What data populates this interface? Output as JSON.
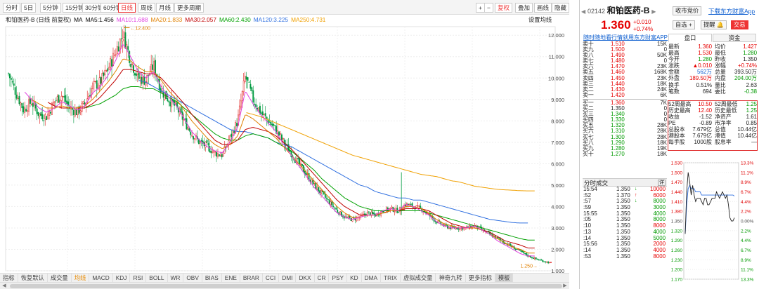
{
  "toolbar": {
    "periods": [
      "分时",
      "5日",
      "5分钟",
      "15分钟",
      "30分钟",
      "60分钟",
      "日线",
      "周线",
      "月线",
      "更多周期"
    ],
    "active_period": "日线",
    "right_buttons": [
      "+",
      "−",
      "复权",
      "叠加",
      "画线",
      "隐藏"
    ]
  },
  "ma_bar": {
    "name": "和铂医药-B (日线 前复权)",
    "items": [
      {
        "label": "MA",
        "value": "",
        "color": "#000000"
      },
      {
        "label": "MA5:",
        "value": "1.456",
        "color": "#000000"
      },
      {
        "label": "MA10:",
        "value": "1.688",
        "color": "#e040e0"
      },
      {
        "label": "MA20:",
        "value": "1.833",
        "color": "#e08000"
      },
      {
        "label": "MA30:",
        "value": "2.057",
        "color": "#c00000"
      },
      {
        "label": "MA60:",
        "value": "2.430",
        "color": "#00a000"
      },
      {
        "label": "MA120:",
        "value": "3.225",
        "color": "#3070e0"
      },
      {
        "label": "MA250:",
        "value": "4.731",
        "color": "#f0a000"
      }
    ],
    "settings": "设置均线"
  },
  "chart_data": {
    "type": "candlestick",
    "y_ticks": [
      "12.000",
      "11.000",
      "10.000",
      "9.000",
      "8.000",
      "7.000",
      "6.000",
      "5.000",
      "4.000",
      "3.000",
      "2.000",
      "1.000"
    ],
    "ylim": [
      1.0,
      12.4
    ],
    "high_label": "12.400",
    "low_label": "1.250",
    "close_path": [
      10.2,
      9.3,
      8.5,
      8.9,
      8.3,
      8.2,
      8.9,
      9.2,
      8.6,
      8.4,
      8.8,
      9.6,
      9.8,
      10.4,
      11.2,
      12.1,
      10.8,
      10.0,
      9.9,
      10.6,
      9.4,
      9.0,
      8.6,
      8.0,
      7.4,
      7.0,
      6.8,
      6.5,
      6.4,
      7.2,
      8.0,
      10.1,
      9.0,
      8.4,
      8.0,
      7.6,
      7.0,
      6.5,
      6.0,
      5.5,
      5.0,
      4.6,
      4.2,
      3.8,
      3.5,
      3.4,
      3.5,
      3.7,
      3.6,
      3.8,
      3.9,
      3.8,
      4.1,
      4.0,
      3.9,
      3.6,
      3.3,
      3.1,
      3.0,
      3.0,
      3.0,
      3.1,
      2.9,
      2.7,
      2.5,
      2.3,
      2.1,
      1.9,
      1.7,
      1.55,
      1.45,
      1.36
    ],
    "ma_lines": [
      {
        "name": "MA250",
        "color": "#f0a000",
        "path": [
          null,
          null,
          null,
          null,
          null,
          null,
          null,
          null,
          null,
          null,
          null,
          null,
          null,
          null,
          null,
          null,
          null,
          null,
          null,
          null,
          null,
          null,
          null,
          null,
          null,
          null,
          null,
          null,
          null,
          null,
          null,
          8.4,
          8.3,
          8.2,
          8.05,
          7.9,
          7.75,
          7.6,
          7.45,
          7.3,
          7.15,
          7.0,
          6.85,
          6.7,
          6.55,
          6.4,
          6.3,
          6.2,
          6.1,
          6.0,
          5.9,
          5.8,
          5.7,
          5.6,
          5.5,
          5.45,
          5.4,
          5.3,
          5.2,
          5.15,
          5.05,
          4.95,
          4.9,
          4.85,
          4.8,
          4.78,
          4.76,
          4.74,
          4.73,
          null,
          null,
          null
        ]
      },
      {
        "name": "MA120",
        "color": "#3070e0",
        "path": [
          null,
          null,
          null,
          null,
          null,
          null,
          null,
          null,
          null,
          null,
          null,
          null,
          null,
          null,
          null,
          null,
          null,
          9.9,
          9.8,
          9.6,
          9.4,
          9.2,
          9.0,
          8.8,
          8.6,
          8.4,
          8.2,
          8.0,
          7.8,
          7.6,
          7.5,
          7.5,
          7.4,
          7.3,
          7.2,
          7.0,
          6.9,
          6.8,
          6.6,
          6.4,
          6.2,
          6.0,
          5.8,
          5.6,
          5.4,
          5.2,
          5.0,
          4.9,
          4.7,
          4.6,
          4.5,
          4.4,
          4.4,
          4.3,
          4.3,
          4.2,
          4.1,
          4.0,
          3.9,
          3.8,
          3.7,
          3.6,
          3.5,
          3.4,
          3.35,
          3.3,
          3.25,
          3.23,
          null,
          null,
          null,
          null
        ]
      },
      {
        "name": "MA60",
        "color": "#00a000",
        "path": [
          null,
          null,
          null,
          null,
          null,
          null,
          null,
          null,
          null,
          null,
          8.6,
          8.7,
          8.8,
          9.0,
          9.2,
          9.5,
          9.6,
          9.6,
          9.5,
          9.5,
          9.3,
          9.1,
          8.9,
          8.6,
          8.3,
          8.0,
          7.7,
          7.4,
          7.2,
          7.1,
          7.1,
          7.3,
          7.4,
          7.3,
          7.2,
          7.0,
          6.8,
          6.6,
          6.3,
          6.0,
          5.7,
          5.3,
          5.0,
          4.7,
          4.4,
          4.2,
          4.0,
          3.9,
          3.8,
          3.8,
          3.8,
          3.8,
          3.8,
          3.8,
          3.8,
          3.7,
          3.6,
          3.5,
          3.4,
          3.3,
          3.2,
          3.1,
          3.0,
          2.9,
          2.8,
          2.7,
          2.6,
          2.5,
          2.43,
          null,
          null,
          null
        ]
      },
      {
        "name": "MA30",
        "color": "#c00000",
        "path": [
          null,
          null,
          null,
          null,
          null,
          8.9,
          8.7,
          8.6,
          8.6,
          8.6,
          8.6,
          8.8,
          9.1,
          9.5,
          9.9,
          10.4,
          10.4,
          10.3,
          10.2,
          10.2,
          10.0,
          9.6,
          9.2,
          8.8,
          8.3,
          7.9,
          7.5,
          7.1,
          6.9,
          6.9,
          7.1,
          7.6,
          7.7,
          7.6,
          7.5,
          7.3,
          7.0,
          6.7,
          6.3,
          5.9,
          5.5,
          5.1,
          4.7,
          4.3,
          4.0,
          3.8,
          3.6,
          3.6,
          3.6,
          3.7,
          3.8,
          3.8,
          3.9,
          3.9,
          3.9,
          3.8,
          3.6,
          3.4,
          3.2,
          3.1,
          3.0,
          3.0,
          2.9,
          2.8,
          2.6,
          2.4,
          2.3,
          2.2,
          2.06,
          null,
          null,
          null
        ]
      },
      {
        "name": "MA20",
        "color": "#e08000",
        "path": [
          null,
          null,
          null,
          9.0,
          8.8,
          8.6,
          8.6,
          8.7,
          8.6,
          8.6,
          8.7,
          9.0,
          9.4,
          9.8,
          10.3,
          10.9,
          10.8,
          10.5,
          10.3,
          10.3,
          9.9,
          9.4,
          9.0,
          8.5,
          8.0,
          7.6,
          7.2,
          6.9,
          6.7,
          6.9,
          7.3,
          8.3,
          8.1,
          7.8,
          7.5,
          7.2,
          6.8,
          6.4,
          6.0,
          5.6,
          5.2,
          4.8,
          4.4,
          4.0,
          3.7,
          3.5,
          3.5,
          3.6,
          3.6,
          3.7,
          3.8,
          3.8,
          4.0,
          4.0,
          3.9,
          3.7,
          3.4,
          3.2,
          3.1,
          3.0,
          3.0,
          3.0,
          2.9,
          2.7,
          2.5,
          2.3,
          2.1,
          2.0,
          1.83,
          null,
          null,
          null
        ]
      },
      {
        "name": "MA10",
        "color": "#e040e0",
        "path": [
          null,
          null,
          9.4,
          9.0,
          8.6,
          8.4,
          8.6,
          8.9,
          8.7,
          8.5,
          8.7,
          9.3,
          9.6,
          10.1,
          10.8,
          11.6,
          11.0,
          10.3,
          10.0,
          10.3,
          9.6,
          9.1,
          8.7,
          8.1,
          7.5,
          7.1,
          6.8,
          6.6,
          6.5,
          7.0,
          7.7,
          9.4,
          8.8,
          8.3,
          7.9,
          7.5,
          6.9,
          6.4,
          5.9,
          5.4,
          4.9,
          4.5,
          4.1,
          3.7,
          3.5,
          3.4,
          3.5,
          3.6,
          3.6,
          3.8,
          3.9,
          3.8,
          4.1,
          4.0,
          3.8,
          3.6,
          3.3,
          3.1,
          3.0,
          3.0,
          3.0,
          3.1,
          2.9,
          2.7,
          2.4,
          2.2,
          2.0,
          1.8,
          1.69,
          null,
          null,
          null
        ]
      }
    ]
  },
  "bottom_tabs": [
    "指标",
    "恢复默认",
    "成交量",
    "均线",
    "MACD",
    "KDJ",
    "RSI",
    "BOLL",
    "WR",
    "OBV",
    "BIAS",
    "ENE",
    "BRAR",
    "CCI",
    "DMI",
    "DKX",
    "CR",
    "PSY",
    "KD",
    "DMA",
    "TRIX",
    "虚拟成交量",
    "神奇九转",
    "更多指标",
    "模板"
  ],
  "stock": {
    "code": "02142",
    "name": "和铂医药-B",
    "price": "1.360",
    "change": "+0.010",
    "change_pct": "+0.74%",
    "btn_self": "自选 +",
    "btn_alert": "提醒",
    "btn_trade": "交易",
    "btn_close": "收市竞价",
    "download": "下载东方财富App",
    "ad": "随时随地看行情就用东方财富APP"
  },
  "order_book": {
    "sell": [
      {
        "label": "卖十",
        "price": "1.510",
        "vol": "15K"
      },
      {
        "label": "卖九",
        "price": "1.500",
        "vol": "0"
      },
      {
        "label": "卖八",
        "price": "1.490",
        "vol": "50K"
      },
      {
        "label": "卖七",
        "price": "1.480",
        "vol": "0"
      },
      {
        "label": "卖六",
        "price": "1.470",
        "vol": "23K"
      },
      {
        "label": "卖五",
        "price": "1.460",
        "vol": "168K"
      },
      {
        "label": "卖四",
        "price": "1.450",
        "vol": "23K"
      },
      {
        "label": "卖三",
        "price": "1.440",
        "vol": "18K"
      },
      {
        "label": "卖二",
        "price": "1.430",
        "vol": "24K"
      },
      {
        "label": "卖一",
        "price": "1.420",
        "vol": "6K"
      }
    ],
    "buy": [
      {
        "label": "买一",
        "price": "1.360",
        "vol": "7K"
      },
      {
        "label": "买二",
        "price": "1.350",
        "vol": "0"
      },
      {
        "label": "买三",
        "price": "1.340",
        "vol": "0"
      },
      {
        "label": "买四",
        "price": "1.330",
        "vol": "0"
      },
      {
        "label": "买五",
        "price": "1.320",
        "vol": "28K"
      },
      {
        "label": "买六",
        "price": "1.310",
        "vol": "28K"
      },
      {
        "label": "买七",
        "price": "1.300",
        "vol": "28K"
      },
      {
        "label": "买八",
        "price": "1.290",
        "vol": "18K"
      },
      {
        "label": "买九",
        "price": "1.280",
        "vol": "19K"
      },
      {
        "label": "买十",
        "price": "1.270",
        "vol": "18K"
      }
    ]
  },
  "right_tabs": [
    "盘口",
    "资金"
  ],
  "stats": [
    {
      "l1": "最新",
      "v1": "1.360",
      "c1": "red",
      "l2": "均价",
      "v2": "1.427",
      "c2": "red"
    },
    {
      "l1": "最高",
      "v1": "1.530",
      "c1": "red",
      "l2": "最低",
      "v2": "1.280",
      "c2": "green"
    },
    {
      "l1": "今开",
      "v1": "1.280",
      "c1": "green",
      "l2": "昨收",
      "v2": "1.350",
      "c2": ""
    },
    {
      "l1": "涨跌",
      "v1": "▲0.010",
      "c1": "red",
      "l2": "涨幅",
      "v2": "+0.74%",
      "c2": "red"
    },
    {
      "l1": "金额",
      "v1": "562万",
      "c1": "blue",
      "l2": "总量",
      "v2": "393.50万",
      "c2": ""
    },
    {
      "l1": "外盘",
      "v1": "189.50万",
      "c1": "red",
      "l2": "内盘",
      "v2": "204.00万",
      "c2": "green"
    },
    {
      "l1": "换手",
      "v1": "0.51%",
      "c1": "",
      "l2": "量比",
      "v2": "2.63",
      "c2": ""
    },
    {
      "l1": "笔数",
      "v1": "694",
      "c1": "",
      "l2": "委比",
      "v2": "-0.38",
      "c2": "green"
    },
    {
      "l1": "52周最高",
      "v1": "10.50",
      "c1": "red",
      "l2": "52周最低",
      "v2": "1.25",
      "c2": "green"
    },
    {
      "l1": "历史最高",
      "v1": "12.40",
      "c1": "red",
      "l2": "历史最低",
      "v2": "1.25",
      "c2": "green"
    },
    {
      "l1": "收益",
      "v1": "-1.52",
      "c1": "",
      "l2": "净资产",
      "v2": "1.61",
      "c2": ""
    },
    {
      "l1": "PE",
      "v1": "-0.89",
      "c1": "",
      "l2": "市净率",
      "v2": "0.85",
      "c2": ""
    },
    {
      "l1": "总股本",
      "v1": "7.679亿",
      "c1": "",
      "l2": "总值",
      "v2": "10.44亿",
      "c2": ""
    },
    {
      "l1": "港股本",
      "v1": "7.679亿",
      "c1": "",
      "l2": "港值",
      "v2": "10.44亿",
      "c2": ""
    },
    {
      "l1": "每手股",
      "v1": "1000股",
      "c1": "",
      "l2": "股息率",
      "v2": "—",
      "c2": ""
    }
  ],
  "trades": {
    "title": "分时成交",
    "more": "详",
    "rows": [
      {
        "t": "15:54",
        "p": "1.350",
        "a": "↓",
        "ac": "green",
        "v": "10000",
        "vc": "red"
      },
      {
        "t": ":52",
        "p": "1.370",
        "a": "↑",
        "ac": "red",
        "v": "6000",
        "vc": "red"
      },
      {
        "t": ":57",
        "p": "1.350",
        "a": "↓",
        "ac": "green",
        "v": "8000",
        "vc": "green"
      },
      {
        "t": ":59",
        "p": "1.350",
        "a": "",
        "ac": "",
        "v": "3000",
        "vc": "green"
      },
      {
        "t": "15:55",
        "p": "1.350",
        "a": "",
        "ac": "",
        "v": "4000",
        "vc": "green"
      },
      {
        "t": ":05",
        "p": "1.350",
        "a": "",
        "ac": "",
        "v": "8000",
        "vc": "green"
      },
      {
        "t": ":10",
        "p": "1.350",
        "a": "",
        "ac": "",
        "v": "8000",
        "vc": "red"
      },
      {
        "t": ":13",
        "p": "1.350",
        "a": "",
        "ac": "",
        "v": "4000",
        "vc": "green"
      },
      {
        "t": ":14",
        "p": "1.350",
        "a": "",
        "ac": "",
        "v": "5000",
        "vc": "green"
      },
      {
        "t": "15:56",
        "p": "1.350",
        "a": "",
        "ac": "",
        "v": "2000",
        "vc": "red"
      },
      {
        "t": ":14",
        "p": "1.350",
        "a": "",
        "ac": "",
        "v": "4000",
        "vc": "red"
      },
      {
        "t": ":53",
        "p": "1.350",
        "a": "",
        "ac": "",
        "v": "8000",
        "vc": "red"
      }
    ]
  },
  "mini_chart": {
    "y_left": [
      "1.530",
      "1.500",
      "1.470",
      "1.440",
      "1.410",
      "1.380",
      "1.350",
      "1.320",
      "1.290",
      "1.260",
      "1.230",
      "1.200",
      "1.170"
    ],
    "y_right": [
      "13.3%",
      "11.1%",
      "8.9%",
      "6.7%",
      "4.4%",
      "2.2%",
      "0.00%",
      "2.2%",
      "4.4%",
      "6.7%",
      "8.9%",
      "11.1%",
      "13.3%"
    ],
    "ylim": [
      1.17,
      1.53
    ],
    "prev_close": 1.35,
    "price_path": [
      1.31,
      1.44,
      1.5,
      1.47,
      1.43,
      1.46,
      1.43,
      1.41,
      1.42,
      1.42,
      1.42,
      1.41,
      1.4,
      1.42,
      1.42,
      1.4,
      1.4,
      1.41,
      1.42,
      1.42,
      1.42,
      1.44,
      1.43,
      1.42,
      1.43,
      1.44,
      1.43,
      1.42,
      1.43,
      1.4,
      1.36,
      1.35,
      1.35,
      1.36
    ],
    "avg_path": [
      1.31,
      1.4,
      1.45,
      1.46,
      1.45,
      1.45,
      1.45,
      1.44,
      1.44,
      1.44,
      1.44,
      1.43,
      1.43,
      1.43,
      1.43,
      1.43,
      1.43,
      1.43,
      1.43,
      1.43,
      1.43,
      1.43,
      1.43,
      1.43,
      1.43,
      1.43,
      1.43,
      1.43,
      1.43,
      1.43,
      1.43,
      1.43,
      1.43,
      1.427
    ]
  }
}
